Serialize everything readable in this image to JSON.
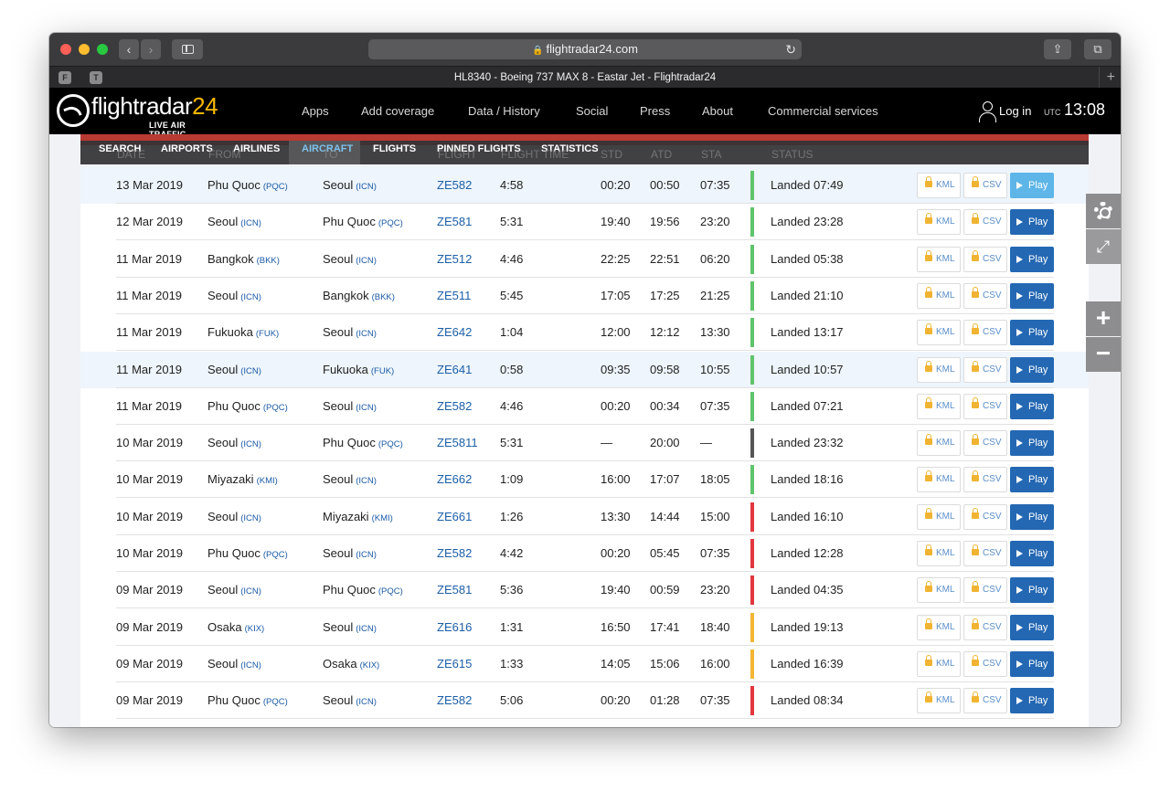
{
  "browser": {
    "url": "flightradar24.com",
    "tab_title": "HL8340 - Boeing 737 MAX 8 - Eastar Jet - Flightradar24",
    "favicons": [
      "F",
      "T"
    ],
    "new_tab_symbol": "+"
  },
  "header": {
    "logo_main": "flightradar",
    "logo_num": "24",
    "logo_tagline": "LIVE AIR TRAFFIC",
    "nav": [
      "Apps",
      "Add coverage",
      "Data / History",
      "Social",
      "Press",
      "About",
      "Commercial services"
    ],
    "login": "Log in",
    "utc_label": "UTC",
    "time": "13:08"
  },
  "subnav": [
    "SEARCH",
    "AIRPORTS",
    "AIRLINES",
    "AIRCRAFT",
    "FLIGHTS",
    "PINNED FLIGHTS",
    "STATISTICS"
  ],
  "columns": [
    "DATE",
    "FROM",
    "TO",
    "FLIGHT",
    "FLIGHT TIME",
    "STD",
    "ATD",
    "STA",
    "STATUS"
  ],
  "buttons": {
    "kml": "KML",
    "csv": "CSV",
    "play": "Play"
  },
  "colors": {
    "green": "#5fc46b",
    "red": "#e2373f",
    "yellow": "#f2b632",
    "gray": "#555555",
    "accent": "#2468b3"
  },
  "rows": [
    {
      "date": "13 Mar 2019",
      "from": "Phu Quoc",
      "from_code": "(PQC)",
      "to": "Seoul",
      "to_code": "(ICN)",
      "flight": "ZE582",
      "flight_time": "4:58",
      "std": "00:20",
      "atd": "00:50",
      "sta": "07:35",
      "status": "Landed 07:49",
      "status_color": "green"
    },
    {
      "date": "12 Mar 2019",
      "from": "Seoul",
      "from_code": "(ICN)",
      "to": "Phu Quoc",
      "to_code": "(PQC)",
      "flight": "ZE581",
      "flight_time": "5:31",
      "std": "19:40",
      "atd": "19:56",
      "sta": "23:20",
      "status": "Landed 23:28",
      "status_color": "green"
    },
    {
      "date": "11 Mar 2019",
      "from": "Bangkok",
      "from_code": "(BKK)",
      "to": "Seoul",
      "to_code": "(ICN)",
      "flight": "ZE512",
      "flight_time": "4:46",
      "std": "22:25",
      "atd": "22:51",
      "sta": "06:20",
      "status": "Landed 05:38",
      "status_color": "green"
    },
    {
      "date": "11 Mar 2019",
      "from": "Seoul",
      "from_code": "(ICN)",
      "to": "Bangkok",
      "to_code": "(BKK)",
      "flight": "ZE511",
      "flight_time": "5:45",
      "std": "17:05",
      "atd": "17:25",
      "sta": "21:25",
      "status": "Landed 21:10",
      "status_color": "green"
    },
    {
      "date": "11 Mar 2019",
      "from": "Fukuoka",
      "from_code": "(FUK)",
      "to": "Seoul",
      "to_code": "(ICN)",
      "flight": "ZE642",
      "flight_time": "1:04",
      "std": "12:00",
      "atd": "12:12",
      "sta": "13:30",
      "status": "Landed 13:17",
      "status_color": "green"
    },
    {
      "date": "11 Mar 2019",
      "from": "Seoul",
      "from_code": "(ICN)",
      "to": "Fukuoka",
      "to_code": "(FUK)",
      "flight": "ZE641",
      "flight_time": "0:58",
      "std": "09:35",
      "atd": "09:58",
      "sta": "10:55",
      "status": "Landed 10:57",
      "status_color": "green"
    },
    {
      "date": "11 Mar 2019",
      "from": "Phu Quoc",
      "from_code": "(PQC)",
      "to": "Seoul",
      "to_code": "(ICN)",
      "flight": "ZE582",
      "flight_time": "4:46",
      "std": "00:20",
      "atd": "00:34",
      "sta": "07:35",
      "status": "Landed 07:21",
      "status_color": "green"
    },
    {
      "date": "10 Mar 2019",
      "from": "Seoul",
      "from_code": "(ICN)",
      "to": "Phu Quoc",
      "to_code": "(PQC)",
      "flight": "ZE5811",
      "flight_time": "5:31",
      "std": "—",
      "atd": "20:00",
      "sta": "—",
      "status": "Landed 23:32",
      "status_color": "gray"
    },
    {
      "date": "10 Mar 2019",
      "from": "Miyazaki",
      "from_code": "(KMI)",
      "to": "Seoul",
      "to_code": "(ICN)",
      "flight": "ZE662",
      "flight_time": "1:09",
      "std": "16:00",
      "atd": "17:07",
      "sta": "18:05",
      "status": "Landed 18:16",
      "status_color": "green"
    },
    {
      "date": "10 Mar 2019",
      "from": "Seoul",
      "from_code": "(ICN)",
      "to": "Miyazaki",
      "to_code": "(KMI)",
      "flight": "ZE661",
      "flight_time": "1:26",
      "std": "13:30",
      "atd": "14:44",
      "sta": "15:00",
      "status": "Landed 16:10",
      "status_color": "red"
    },
    {
      "date": "10 Mar 2019",
      "from": "Phu Quoc",
      "from_code": "(PQC)",
      "to": "Seoul",
      "to_code": "(ICN)",
      "flight": "ZE582",
      "flight_time": "4:42",
      "std": "00:20",
      "atd": "05:45",
      "sta": "07:35",
      "status": "Landed 12:28",
      "status_color": "red"
    },
    {
      "date": "09 Mar 2019",
      "from": "Seoul",
      "from_code": "(ICN)",
      "to": "Phu Quoc",
      "to_code": "(PQC)",
      "flight": "ZE581",
      "flight_time": "5:36",
      "std": "19:40",
      "atd": "00:59",
      "sta": "23:20",
      "status": "Landed 04:35",
      "status_color": "red"
    },
    {
      "date": "09 Mar 2019",
      "from": "Osaka",
      "from_code": "(KIX)",
      "to": "Seoul",
      "to_code": "(ICN)",
      "flight": "ZE616",
      "flight_time": "1:31",
      "std": "16:50",
      "atd": "17:41",
      "sta": "18:40",
      "status": "Landed 19:13",
      "status_color": "yellow"
    },
    {
      "date": "09 Mar 2019",
      "from": "Seoul",
      "from_code": "(ICN)",
      "to": "Osaka",
      "to_code": "(KIX)",
      "flight": "ZE615",
      "flight_time": "1:33",
      "std": "14:05",
      "atd": "15:06",
      "sta": "16:00",
      "status": "Landed 16:39",
      "status_color": "yellow"
    },
    {
      "date": "09 Mar 2019",
      "from": "Phu Quoc",
      "from_code": "(PQC)",
      "to": "Seoul",
      "to_code": "(ICN)",
      "flight": "ZE582",
      "flight_time": "5:06",
      "std": "00:20",
      "atd": "01:28",
      "sta": "07:35",
      "status": "Landed 08:34",
      "status_color": "red"
    }
  ],
  "side_tools": {
    "zoom_in": "+",
    "zoom_out": "−"
  }
}
